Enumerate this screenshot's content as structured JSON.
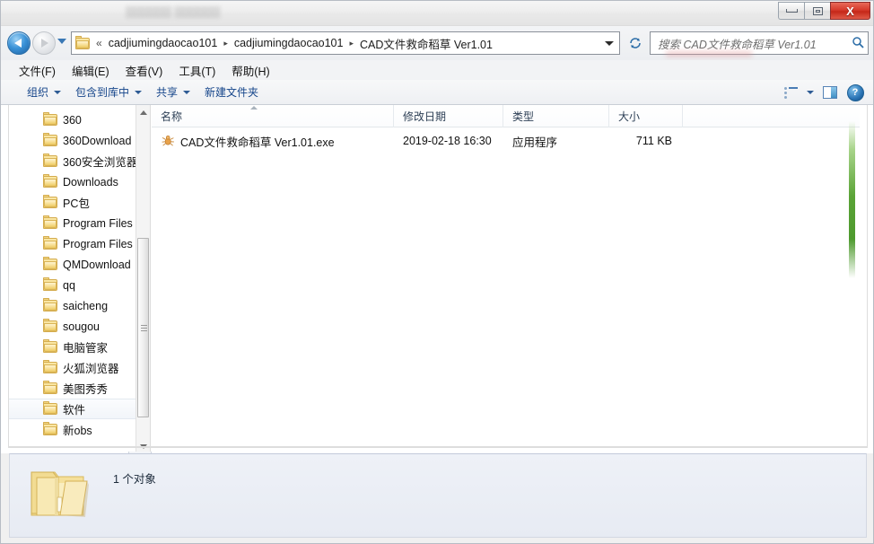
{
  "window": {
    "title_blurred": "▒▒▒▒▒▒  ▒▒▒▒▒▒",
    "controls": {
      "minimize_label": "",
      "maximize_label": "",
      "close_label": "X"
    }
  },
  "addressbar": {
    "back_tooltip": "后退",
    "forward_tooltip": "前进",
    "overflow_chevron": "«",
    "separator": "▸",
    "crumbs": [
      "cadjiumingdaocao101",
      "cadjiumingdaocao101",
      "CAD文件救命稻草 Ver1.01"
    ],
    "refresh_glyph": "↯"
  },
  "search": {
    "placeholder": "搜索 CAD文件救命稻草 Ver1.01",
    "value": "",
    "icon_glyph": "🔍"
  },
  "menubar": {
    "items": [
      "文件(F)",
      "编辑(E)",
      "查看(V)",
      "工具(T)",
      "帮助(H)"
    ]
  },
  "toolbar": {
    "items": [
      {
        "label": "组织",
        "has_caret": true
      },
      {
        "label": "包含到库中",
        "has_caret": true
      },
      {
        "label": "共享",
        "has_caret": true
      },
      {
        "label": "新建文件夹",
        "has_caret": false
      }
    ],
    "right_icons": [
      "view-options-icon",
      "view-options-caret",
      "preview-pane-icon",
      "help-icon"
    ],
    "help_glyph": "?"
  },
  "navigation_pane": {
    "items": [
      "360",
      "360Download",
      "360安全浏览器",
      "Downloads",
      "PC包",
      "Program Files",
      "Program Files",
      "QMDownload",
      "qq",
      "saicheng",
      "sougou",
      "电脑管家",
      "火狐浏览器",
      "美图秀秀",
      "软件",
      "新obs"
    ],
    "selected_index": 14
  },
  "filelist": {
    "columns": [
      "名称",
      "修改日期",
      "类型",
      "大小"
    ],
    "sort_column": "名称",
    "sort_direction": "asc",
    "rows": [
      {
        "name": "CAD文件救命稻草 Ver1.01.exe",
        "date": "2019-02-18 16:30",
        "type": "应用程序",
        "size": "711 KB",
        "icon": "application-exe-icon"
      }
    ]
  },
  "details_pane": {
    "object_count_text": "1 个对象",
    "folder_icon": "large-folder-icon"
  },
  "colors": {
    "accent_blue": "#15458a",
    "window_chrome": "#f0f0f0",
    "close_button_red": "#d63a2c",
    "folder_yellow": "#f0cf6c",
    "green_strip": "#5aa336",
    "selection_bg": "#f2f5f9"
  }
}
